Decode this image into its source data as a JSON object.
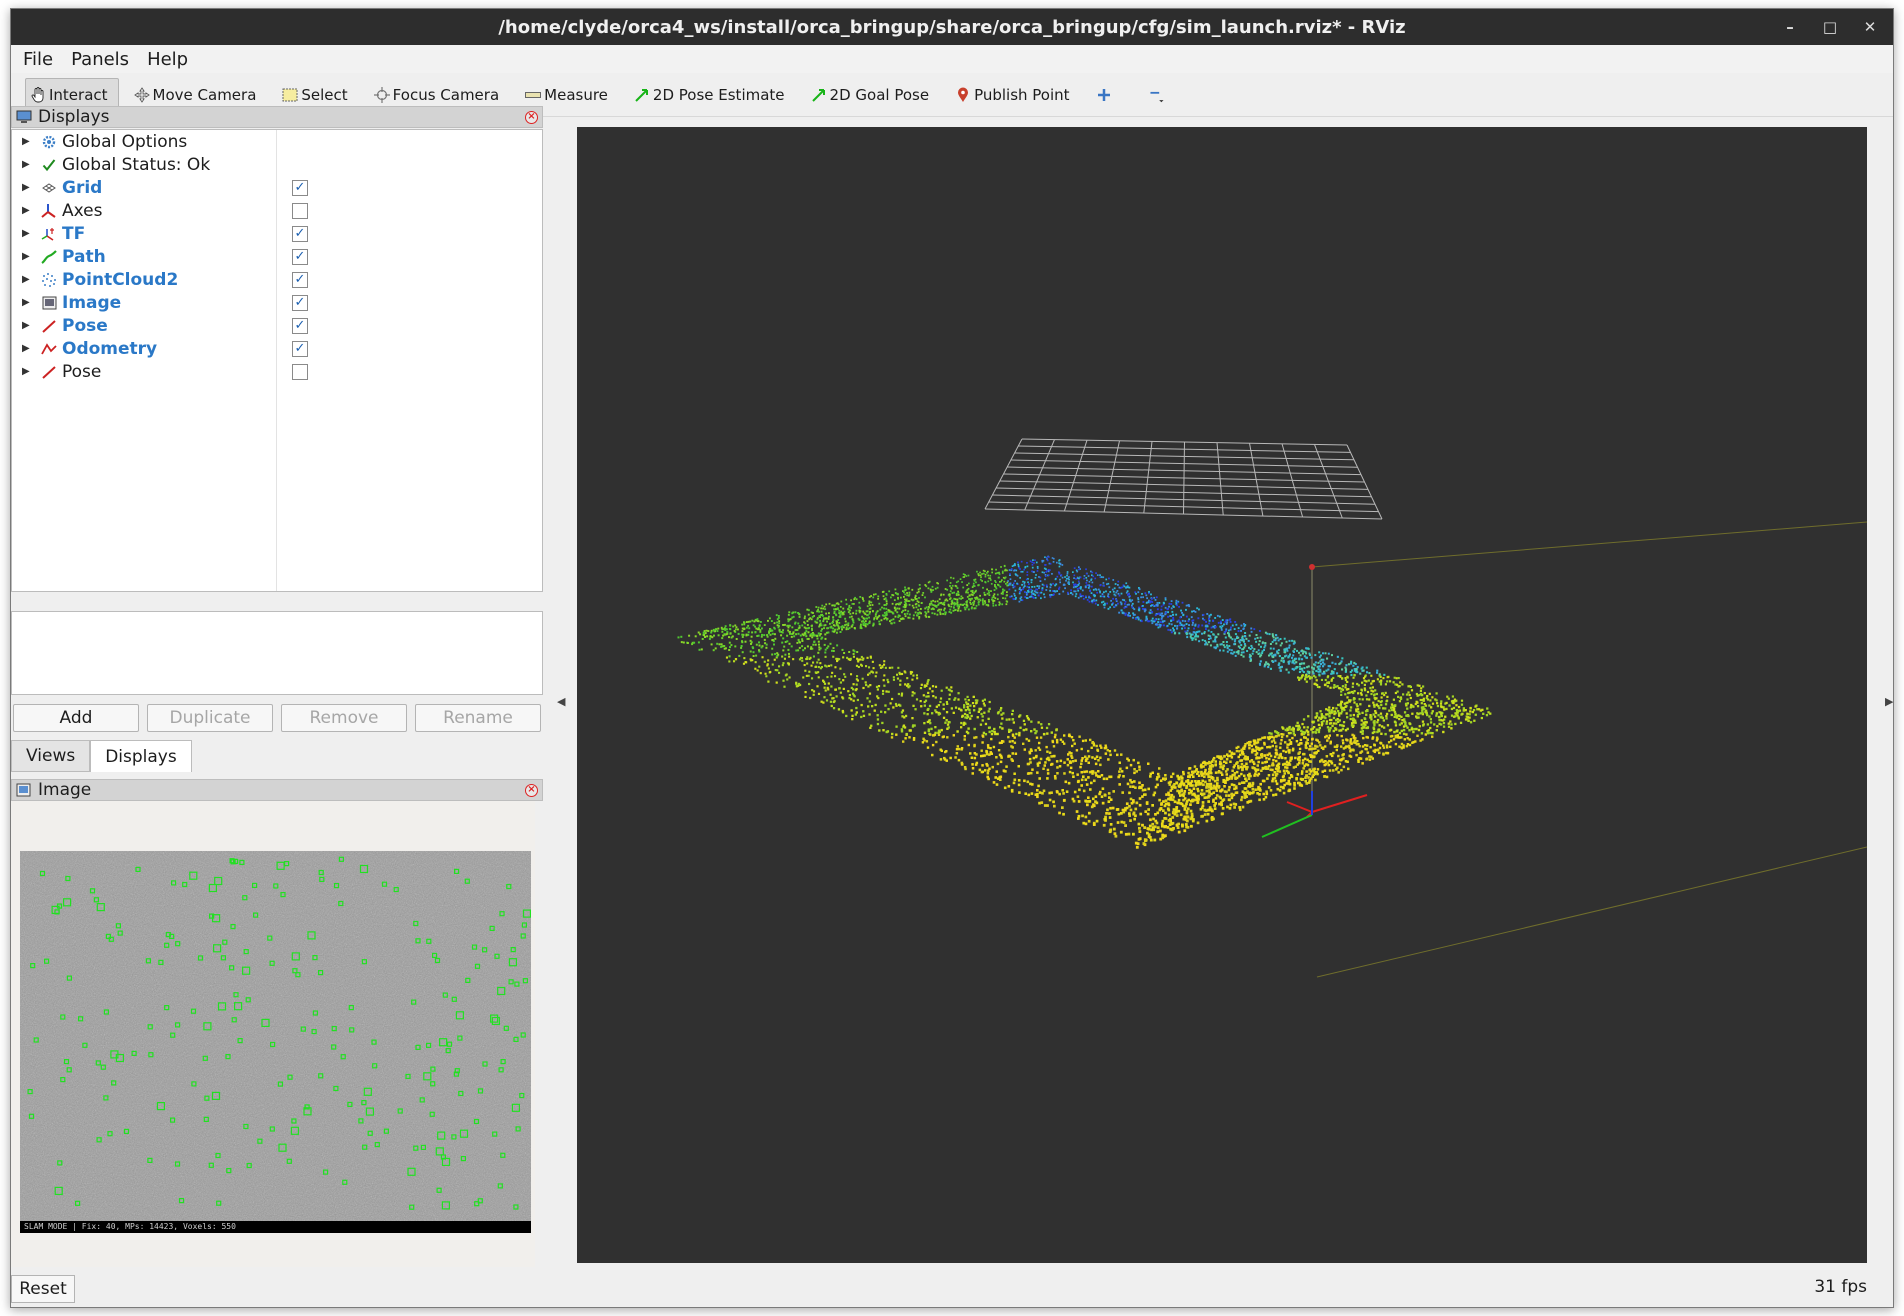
{
  "window": {
    "title": "/home/clyde/orca4_ws/install/orca_bringup/share/orca_bringup/cfg/sim_launch.rviz* - RViz",
    "controls": {
      "minimize": "–",
      "maximize": "□",
      "close": "✕"
    }
  },
  "menu": [
    {
      "label": "File"
    },
    {
      "label": "Panels"
    },
    {
      "label": "Help"
    }
  ],
  "toolbar": [
    {
      "label": "Interact",
      "icon": "hand-cursor-icon",
      "active": true
    },
    {
      "label": "Move Camera",
      "icon": "move-camera-icon"
    },
    {
      "label": "Select",
      "icon": "select-box-icon"
    },
    {
      "label": "Focus Camera",
      "icon": "focus-camera-icon"
    },
    {
      "label": "Measure",
      "icon": "ruler-icon"
    },
    {
      "label": "2D Pose Estimate",
      "icon": "green-arrow-icon"
    },
    {
      "label": "2D Goal Pose",
      "icon": "green-arrow-icon"
    },
    {
      "label": "Publish Point",
      "icon": "map-pin-icon"
    },
    {
      "label": "",
      "icon": "plus-icon"
    },
    {
      "label": "",
      "icon": "minus-dropdown-icon"
    }
  ],
  "displays_panel": {
    "title": "Displays",
    "items": [
      {
        "label": "Global Options",
        "icon": "gear-icon",
        "color": "#3c7fc7",
        "bold": false,
        "checkbox": null
      },
      {
        "label": "Global Status: Ok",
        "icon": "checkmark-icon",
        "color": "#1f8a1f",
        "bold": false,
        "checkbox": null
      },
      {
        "label": "Grid",
        "icon": "grid-icon",
        "color": "#555555",
        "bold": true,
        "checkbox": true
      },
      {
        "label": "Axes",
        "icon": "axes-icon",
        "color": "#cc2222",
        "bold": false,
        "checkbox": false
      },
      {
        "label": "TF",
        "icon": "tf-icon",
        "color": "#cc2222",
        "bold": true,
        "checkbox": true
      },
      {
        "label": "Path",
        "icon": "path-icon",
        "color": "#22aa22",
        "bold": true,
        "checkbox": true
      },
      {
        "label": "PointCloud2",
        "icon": "pointcloud-icon",
        "color": "#3c7fc7",
        "bold": true,
        "checkbox": true
      },
      {
        "label": "Image",
        "icon": "image-icon",
        "color": "#555555",
        "bold": true,
        "checkbox": true
      },
      {
        "label": "Pose",
        "icon": "pose-arrow-icon",
        "color": "#cc2222",
        "bold": true,
        "checkbox": true
      },
      {
        "label": "Odometry",
        "icon": "odometry-icon",
        "color": "#cc2222",
        "bold": true,
        "checkbox": true
      },
      {
        "label": "Pose",
        "icon": "pose-arrow-icon",
        "color": "#cc2222",
        "bold": false,
        "checkbox": false
      }
    ],
    "buttons": [
      {
        "label": "Add",
        "enabled": true
      },
      {
        "label": "Duplicate",
        "enabled": false
      },
      {
        "label": "Remove",
        "enabled": false
      },
      {
        "label": "Rename",
        "enabled": false
      }
    ],
    "tabs": [
      {
        "label": "Views",
        "active": false
      },
      {
        "label": "Displays",
        "active": true
      }
    ]
  },
  "image_panel": {
    "title": "Image",
    "status_text": "SLAM MODE | Fix: 40, MPs: 14423, Voxels: 550"
  },
  "bottom": {
    "reset_label": "Reset",
    "fps": "31 fps"
  },
  "colors": {
    "viewport_bg": "#303030",
    "selected_blue": "#2a78c7"
  }
}
